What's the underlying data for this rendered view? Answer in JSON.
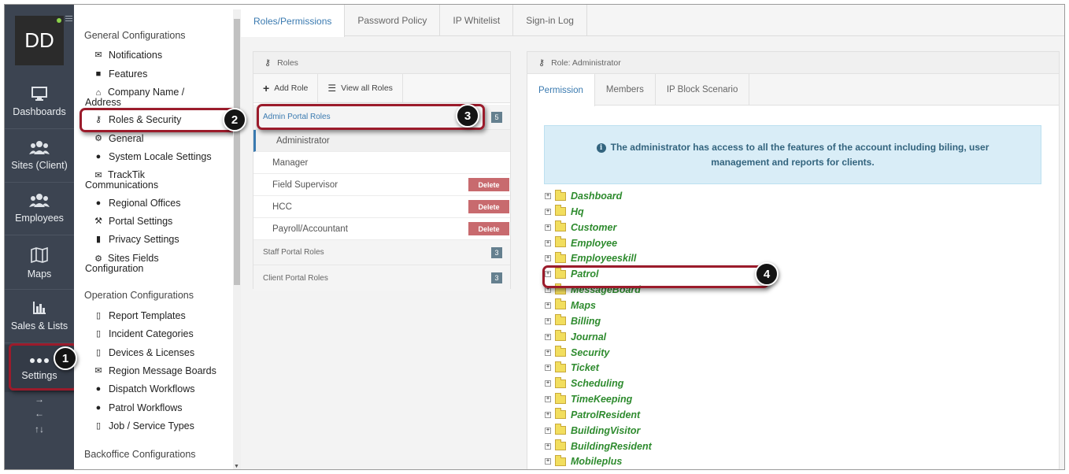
{
  "avatar": {
    "initials": "DD"
  },
  "nav": [
    {
      "label": "Dashboards",
      "icon": "monitor-icon"
    },
    {
      "label": "Sites (Client)",
      "icon": "sites-icon"
    },
    {
      "label": "Employees",
      "icon": "employees-icon"
    },
    {
      "label": "Maps",
      "icon": "map-icon"
    },
    {
      "label": "Sales & Lists",
      "icon": "bar-chart-icon"
    },
    {
      "label": "Settings",
      "icon": "more-dots-icon"
    }
  ],
  "nav_arrows": [
    "→",
    "←",
    "↑↓"
  ],
  "config": {
    "general_heading": "General Configurations",
    "general_items": [
      {
        "label": "Notifications",
        "icon": "envelope-icon"
      },
      {
        "label": "Features",
        "icon": "briefcase-icon"
      },
      {
        "label": "Company Name / Address",
        "icon": "home-icon"
      },
      {
        "label": "Roles & Security",
        "icon": "key-icon"
      },
      {
        "label": "General",
        "icon": "gear-icon"
      },
      {
        "label": "System Locale Settings",
        "icon": "globe-icon"
      },
      {
        "label": "TrackTik Communications",
        "icon": "envelope-icon"
      },
      {
        "label": "Regional Offices",
        "icon": "globe-icon"
      },
      {
        "label": "Portal Settings",
        "icon": "wrench-icon"
      },
      {
        "label": "Privacy Settings",
        "icon": "lock-icon"
      },
      {
        "label": "Sites Fields Configuration",
        "icon": "gear-icon"
      }
    ],
    "operation_heading": "Operation Configurations",
    "operation_items": [
      {
        "label": "Report Templates",
        "icon": "file-icon"
      },
      {
        "label": "Incident Categories",
        "icon": "file-icon"
      },
      {
        "label": "Devices & Licenses",
        "icon": "mobile-icon"
      },
      {
        "label": "Region Message Boards",
        "icon": "envelope-icon"
      },
      {
        "label": "Dispatch Workflows",
        "icon": "globe-icon"
      },
      {
        "label": "Patrol Workflows",
        "icon": "globe-icon"
      },
      {
        "label": "Job / Service Types",
        "icon": "file-icon"
      }
    ],
    "backoffice_heading": "Backoffice Configurations"
  },
  "top_tabs": [
    "Roles/Permissions",
    "Password Policy",
    "IP Whitelist",
    "Sign-in Log"
  ],
  "roles_panel": {
    "title": "Roles",
    "add_role": "Add Role",
    "view_all": "View all Roles",
    "admin_group": {
      "label": "Admin Portal Roles",
      "count": "5"
    },
    "admin_roles": [
      {
        "label": "Administrator",
        "delete": ""
      },
      {
        "label": "Manager",
        "delete": ""
      },
      {
        "label": "Field Supervisor",
        "delete": "Delete"
      },
      {
        "label": "HCC",
        "delete": "Delete"
      },
      {
        "label": "Payroll/Accountant",
        "delete": "Delete"
      }
    ],
    "staff_group": {
      "label": "Staff Portal Roles",
      "count": "3"
    },
    "client_group": {
      "label": "Client Portal Roles",
      "count": "3"
    }
  },
  "role_panel": {
    "title": "Role: Administrator",
    "tabs": [
      "Permission",
      "Members",
      "IP Block Scenario"
    ],
    "info": "The administrator has access to all the features of the account including biling, user management and reports for clients.",
    "tree": [
      "Dashboard",
      "Hq",
      "Customer",
      "Employee",
      "Employeeskill",
      "Patrol",
      "MessageBoard",
      "Maps",
      "Billing",
      "Journal",
      "Security",
      "Ticket",
      "Scheduling",
      "TimeKeeping",
      "PatrolResident",
      "BuildingVisitor",
      "BuildingResident",
      "Mobileplus"
    ]
  },
  "callouts": [
    "1",
    "2",
    "3",
    "4"
  ],
  "colors": {
    "accent": "#3a7ab0",
    "callout_border": "#9b1b2b",
    "delete": "#c86a6e",
    "tree_text": "#2e8b2e",
    "nav_bg": "#3c4451"
  }
}
